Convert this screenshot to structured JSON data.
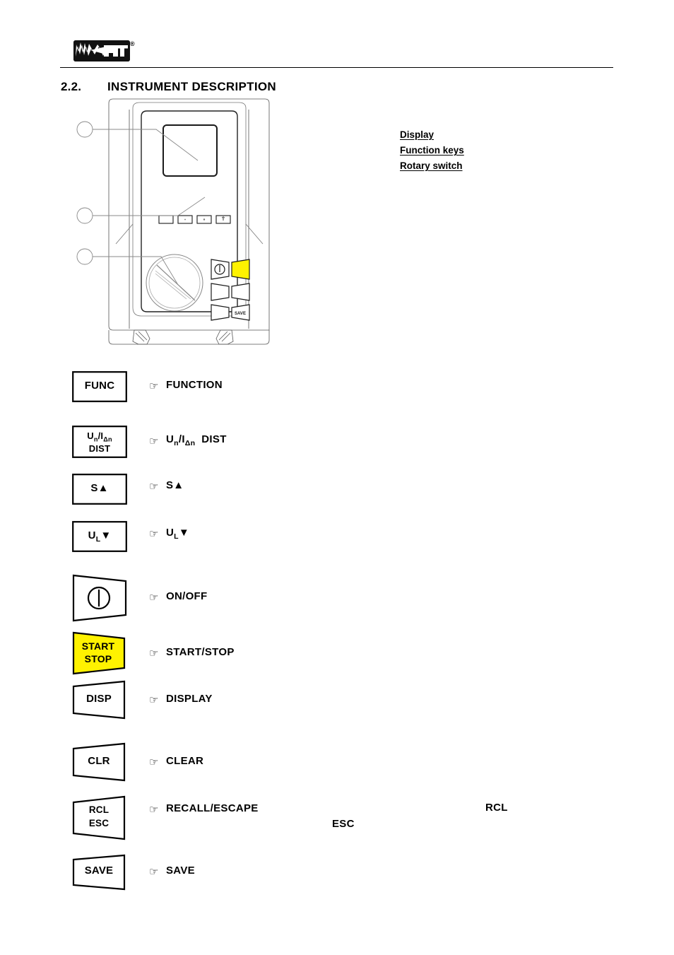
{
  "header": {
    "logo_text": "HT",
    "logo_registered": "®",
    "logo_icon": "ht-waveform-logo"
  },
  "section": {
    "number": "2.2.",
    "title": "INSTRUMENT DESCRIPTION"
  },
  "device": {
    "name": "instrument-front-panel",
    "display_label": "display-screen",
    "function_keys_label": "function-keys-row",
    "rotary_switch_label": "rotary-switch-knob",
    "keypad": {
      "on_off": "power-symbol",
      "start_stop": "start-stop-key",
      "save": "SAVE"
    },
    "accent_color": "#FFF200"
  },
  "callouts": [
    {
      "label": "Display"
    },
    {
      "label": "Function keys"
    },
    {
      "label": "Rotary switch"
    }
  ],
  "keys": [
    {
      "id": "func",
      "shape": "rect",
      "art_lines": [
        "FUNC"
      ],
      "desc": "FUNCTION",
      "desc_html": "FUNCTION",
      "pointer": "☞"
    },
    {
      "id": "un-idn-dist",
      "shape": "rect",
      "art_lines": [
        "Uₙ/IΔₙ",
        "DIST"
      ],
      "art_html_1": "U<sub>n</sub>/I<sub>Δn</sub>",
      "art_html_2": "DIST",
      "desc": "Uₙ/IΔₙ  DIST",
      "desc_html": "U<sub>n</sub>/I<sub>Δn</sub>&nbsp; DIST",
      "pointer": "☞"
    },
    {
      "id": "s-up",
      "shape": "rect",
      "art_lines": [
        "S▲"
      ],
      "desc": "S▲",
      "desc_html": "S▲",
      "pointer": "☞"
    },
    {
      "id": "ul-down",
      "shape": "rect",
      "art_lines": [
        "Uʟ▼"
      ],
      "art_html_1": "U<sub>L</sub>▼",
      "desc": "Uʟ▼",
      "desc_html": "U<sub>L</sub>▼",
      "pointer": "☞"
    },
    {
      "id": "on-off",
      "shape": "trap-left",
      "art_lines": [],
      "icon": "power-icon",
      "desc": "ON/OFF",
      "desc_html": "ON/OFF",
      "pointer": "☞"
    },
    {
      "id": "start-stop",
      "shape": "trap-left",
      "art_lines": [
        "START",
        "STOP"
      ],
      "art_html_1": "START",
      "art_html_2": "STOP",
      "fill": "#FFF200",
      "desc": "START/STOP",
      "desc_html": "START/STOP",
      "pointer": "☞"
    },
    {
      "id": "disp",
      "shape": "trap-right",
      "art_lines": [
        "DISP"
      ],
      "art_html_1": "DISP",
      "desc": "DISPLAY",
      "desc_html": "DISPLAY",
      "pointer": "☞"
    },
    {
      "id": "clr",
      "shape": "trap-right",
      "art_lines": [
        "CLR"
      ],
      "art_html_1": "CLR",
      "desc": "CLEAR",
      "desc_html": "CLEAR",
      "pointer": "☞"
    },
    {
      "id": "rcl-esc",
      "shape": "trap-right",
      "art_lines": [
        "RCL",
        "ESC"
      ],
      "art_html_1": "RCL",
      "art_html_2": "ESC",
      "desc": "RECALL/ESCAPE",
      "desc_html": "RECALL/ESCAPE",
      "pointer": "☞"
    },
    {
      "id": "save",
      "shape": "trap-right",
      "art_lines": [
        "SAVE"
      ],
      "art_html_1": "SAVE",
      "desc": "SAVE",
      "desc_html": "SAVE",
      "pointer": "☞"
    }
  ],
  "stray_text": [
    {
      "id": "stray-rcl",
      "text": "RCL"
    },
    {
      "id": "stray-esc",
      "text": "ESC"
    }
  ]
}
